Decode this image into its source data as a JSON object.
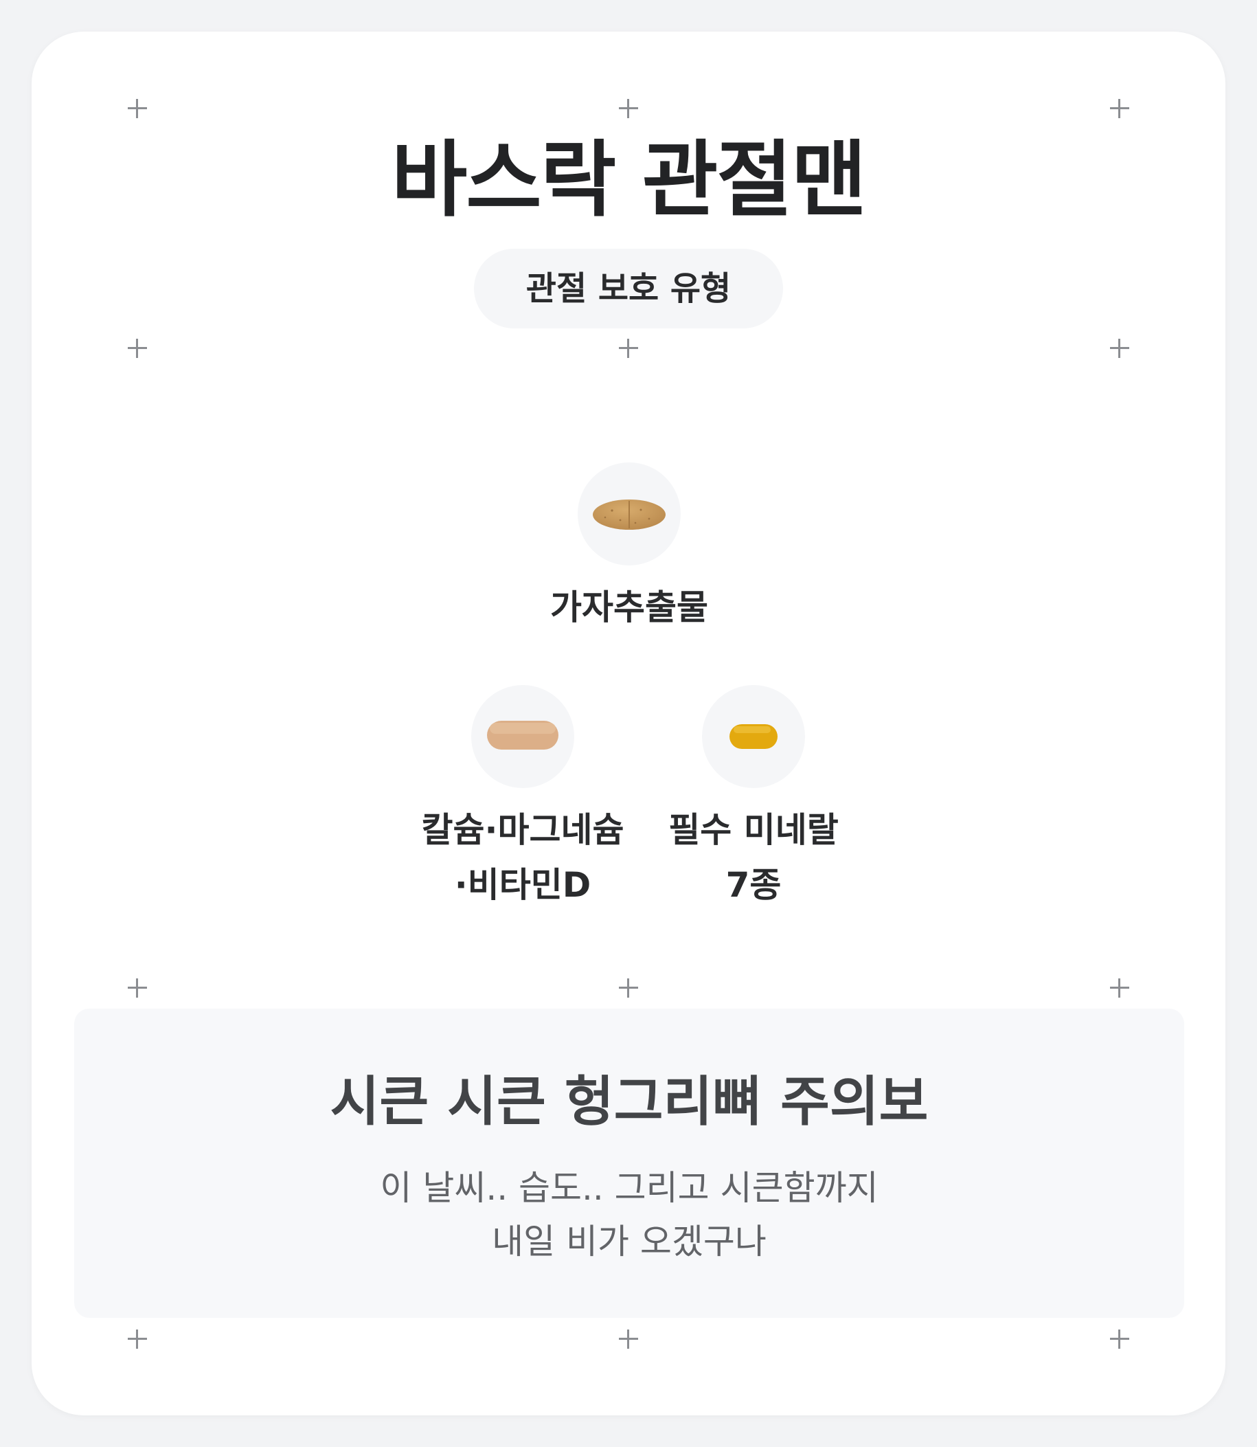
{
  "product": {
    "title": "바스락 관절맨",
    "type_chip": "관절 보호 유형"
  },
  "ingredients": [
    {
      "label_lines": [
        "가자추출물"
      ],
      "pill_icon": "speckled-brown-oval-tablet-icon",
      "pill_color": "#c99a5b"
    },
    {
      "label_lines": [
        "칼슘·마그네슘",
        "·비타민D"
      ],
      "pill_icon": "beige-oblong-tablet-icon",
      "pill_color": "#ddb08a"
    },
    {
      "label_lines": [
        "필수 미네랄",
        "7종"
      ],
      "pill_icon": "yellow-softgel-icon",
      "pill_color": "#e7ad12"
    }
  ],
  "notice": {
    "title": "시큰 시큰 헝그리뼈 주의보",
    "lines": [
      "이 날씨.. 습도.. 그리고 시큰함까지",
      "내일 비가 오겠구나"
    ]
  },
  "colors": {
    "page_background": "#f2f3f5",
    "card": "#ffffff",
    "chip_background": "#f5f6f8",
    "plus_mark": "#8b8d91",
    "title_text": "#222325"
  }
}
